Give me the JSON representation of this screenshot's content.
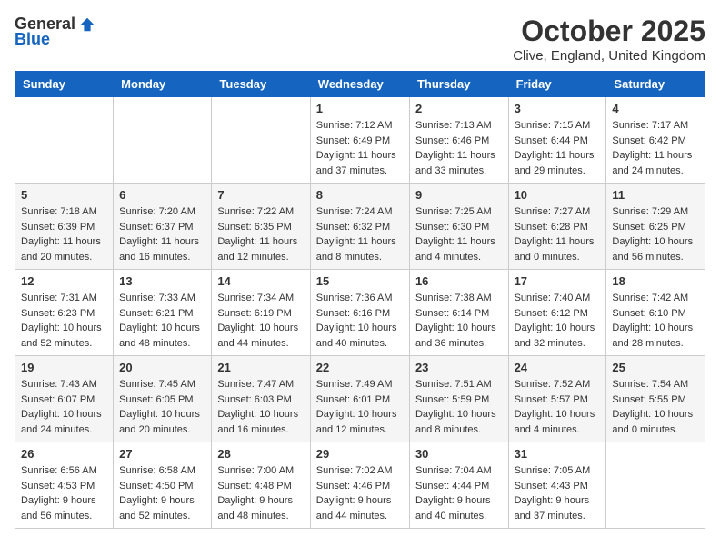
{
  "header": {
    "logo_general": "General",
    "logo_blue": "Blue",
    "month_title": "October 2025",
    "location": "Clive, England, United Kingdom"
  },
  "days_of_week": [
    "Sunday",
    "Monday",
    "Tuesday",
    "Wednesday",
    "Thursday",
    "Friday",
    "Saturday"
  ],
  "weeks": [
    [
      {
        "day": "",
        "sunrise": "",
        "sunset": "",
        "daylight": ""
      },
      {
        "day": "",
        "sunrise": "",
        "sunset": "",
        "daylight": ""
      },
      {
        "day": "",
        "sunrise": "",
        "sunset": "",
        "daylight": ""
      },
      {
        "day": "1",
        "sunrise": "Sunrise: 7:12 AM",
        "sunset": "Sunset: 6:49 PM",
        "daylight": "Daylight: 11 hours and 37 minutes."
      },
      {
        "day": "2",
        "sunrise": "Sunrise: 7:13 AM",
        "sunset": "Sunset: 6:46 PM",
        "daylight": "Daylight: 11 hours and 33 minutes."
      },
      {
        "day": "3",
        "sunrise": "Sunrise: 7:15 AM",
        "sunset": "Sunset: 6:44 PM",
        "daylight": "Daylight: 11 hours and 29 minutes."
      },
      {
        "day": "4",
        "sunrise": "Sunrise: 7:17 AM",
        "sunset": "Sunset: 6:42 PM",
        "daylight": "Daylight: 11 hours and 24 minutes."
      }
    ],
    [
      {
        "day": "5",
        "sunrise": "Sunrise: 7:18 AM",
        "sunset": "Sunset: 6:39 PM",
        "daylight": "Daylight: 11 hours and 20 minutes."
      },
      {
        "day": "6",
        "sunrise": "Sunrise: 7:20 AM",
        "sunset": "Sunset: 6:37 PM",
        "daylight": "Daylight: 11 hours and 16 minutes."
      },
      {
        "day": "7",
        "sunrise": "Sunrise: 7:22 AM",
        "sunset": "Sunset: 6:35 PM",
        "daylight": "Daylight: 11 hours and 12 minutes."
      },
      {
        "day": "8",
        "sunrise": "Sunrise: 7:24 AM",
        "sunset": "Sunset: 6:32 PM",
        "daylight": "Daylight: 11 hours and 8 minutes."
      },
      {
        "day": "9",
        "sunrise": "Sunrise: 7:25 AM",
        "sunset": "Sunset: 6:30 PM",
        "daylight": "Daylight: 11 hours and 4 minutes."
      },
      {
        "day": "10",
        "sunrise": "Sunrise: 7:27 AM",
        "sunset": "Sunset: 6:28 PM",
        "daylight": "Daylight: 11 hours and 0 minutes."
      },
      {
        "day": "11",
        "sunrise": "Sunrise: 7:29 AM",
        "sunset": "Sunset: 6:25 PM",
        "daylight": "Daylight: 10 hours and 56 minutes."
      }
    ],
    [
      {
        "day": "12",
        "sunrise": "Sunrise: 7:31 AM",
        "sunset": "Sunset: 6:23 PM",
        "daylight": "Daylight: 10 hours and 52 minutes."
      },
      {
        "day": "13",
        "sunrise": "Sunrise: 7:33 AM",
        "sunset": "Sunset: 6:21 PM",
        "daylight": "Daylight: 10 hours and 48 minutes."
      },
      {
        "day": "14",
        "sunrise": "Sunrise: 7:34 AM",
        "sunset": "Sunset: 6:19 PM",
        "daylight": "Daylight: 10 hours and 44 minutes."
      },
      {
        "day": "15",
        "sunrise": "Sunrise: 7:36 AM",
        "sunset": "Sunset: 6:16 PM",
        "daylight": "Daylight: 10 hours and 40 minutes."
      },
      {
        "day": "16",
        "sunrise": "Sunrise: 7:38 AM",
        "sunset": "Sunset: 6:14 PM",
        "daylight": "Daylight: 10 hours and 36 minutes."
      },
      {
        "day": "17",
        "sunrise": "Sunrise: 7:40 AM",
        "sunset": "Sunset: 6:12 PM",
        "daylight": "Daylight: 10 hours and 32 minutes."
      },
      {
        "day": "18",
        "sunrise": "Sunrise: 7:42 AM",
        "sunset": "Sunset: 6:10 PM",
        "daylight": "Daylight: 10 hours and 28 minutes."
      }
    ],
    [
      {
        "day": "19",
        "sunrise": "Sunrise: 7:43 AM",
        "sunset": "Sunset: 6:07 PM",
        "daylight": "Daylight: 10 hours and 24 minutes."
      },
      {
        "day": "20",
        "sunrise": "Sunrise: 7:45 AM",
        "sunset": "Sunset: 6:05 PM",
        "daylight": "Daylight: 10 hours and 20 minutes."
      },
      {
        "day": "21",
        "sunrise": "Sunrise: 7:47 AM",
        "sunset": "Sunset: 6:03 PM",
        "daylight": "Daylight: 10 hours and 16 minutes."
      },
      {
        "day": "22",
        "sunrise": "Sunrise: 7:49 AM",
        "sunset": "Sunset: 6:01 PM",
        "daylight": "Daylight: 10 hours and 12 minutes."
      },
      {
        "day": "23",
        "sunrise": "Sunrise: 7:51 AM",
        "sunset": "Sunset: 5:59 PM",
        "daylight": "Daylight: 10 hours and 8 minutes."
      },
      {
        "day": "24",
        "sunrise": "Sunrise: 7:52 AM",
        "sunset": "Sunset: 5:57 PM",
        "daylight": "Daylight: 10 hours and 4 minutes."
      },
      {
        "day": "25",
        "sunrise": "Sunrise: 7:54 AM",
        "sunset": "Sunset: 5:55 PM",
        "daylight": "Daylight: 10 hours and 0 minutes."
      }
    ],
    [
      {
        "day": "26",
        "sunrise": "Sunrise: 6:56 AM",
        "sunset": "Sunset: 4:53 PM",
        "daylight": "Daylight: 9 hours and 56 minutes."
      },
      {
        "day": "27",
        "sunrise": "Sunrise: 6:58 AM",
        "sunset": "Sunset: 4:50 PM",
        "daylight": "Daylight: 9 hours and 52 minutes."
      },
      {
        "day": "28",
        "sunrise": "Sunrise: 7:00 AM",
        "sunset": "Sunset: 4:48 PM",
        "daylight": "Daylight: 9 hours and 48 minutes."
      },
      {
        "day": "29",
        "sunrise": "Sunrise: 7:02 AM",
        "sunset": "Sunset: 4:46 PM",
        "daylight": "Daylight: 9 hours and 44 minutes."
      },
      {
        "day": "30",
        "sunrise": "Sunrise: 7:04 AM",
        "sunset": "Sunset: 4:44 PM",
        "daylight": "Daylight: 9 hours and 40 minutes."
      },
      {
        "day": "31",
        "sunrise": "Sunrise: 7:05 AM",
        "sunset": "Sunset: 4:43 PM",
        "daylight": "Daylight: 9 hours and 37 minutes."
      },
      {
        "day": "",
        "sunrise": "",
        "sunset": "",
        "daylight": ""
      }
    ]
  ]
}
